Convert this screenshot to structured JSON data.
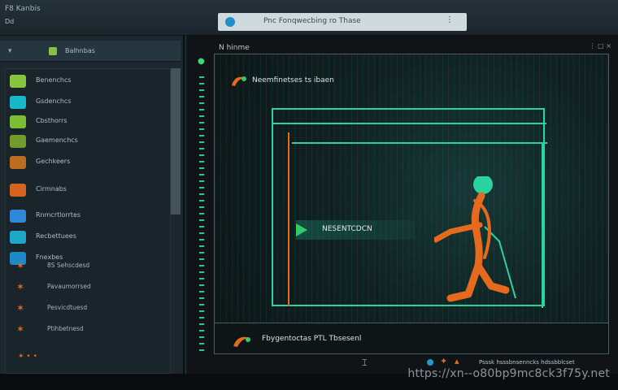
{
  "window": {
    "app_title": "F8 Kanbis",
    "menu_item": "Dd"
  },
  "addressbar": {
    "text": "Pnc  Fonqwecbing ro Thase",
    "close": "⋮"
  },
  "sidebar": {
    "header_label": "Balhnbas",
    "items": [
      {
        "label": "Benenchcs",
        "icon_color": "#86c440",
        "icon": "leaf-icon"
      },
      {
        "label": "Gsdenchcs",
        "icon_color": "#17b6c9",
        "icon": "monitor-icon"
      },
      {
        "label": "Cbsthorrs",
        "icon_color": "#7bbd35",
        "icon": "leaf-icon"
      },
      {
        "label": "Gaemenchcs",
        "icon_color": "#6f9c2c",
        "icon": "leaf-icon"
      },
      {
        "label": "Gechkeers",
        "icon_color": "#b96f1f",
        "icon": "leaf-icon"
      },
      {
        "label": "Cirmnabs",
        "icon_color": "#d4641f",
        "icon": "tag-icon"
      },
      {
        "label": "Rnmcrtlorrtes",
        "icon_color": "#2f87d6",
        "icon": "window-icon"
      },
      {
        "label": "Recbettuees",
        "icon_color": "#1ea7c9",
        "icon": "window-icon"
      },
      {
        "label": "Fnexbes",
        "icon_color": "#1f88c7",
        "icon": "window-icon"
      },
      {
        "label": "Lobrersd",
        "icon_color": "#2893cf",
        "icon": "window-icon"
      }
    ],
    "subitems": [
      {
        "label": "8S Sehscdesd"
      },
      {
        "label": "Pavaumorrsed"
      },
      {
        "label": "Pesvicdtuesd"
      },
      {
        "label": "Ptihbetnesd"
      }
    ],
    "footer_glyph": "✶ • •"
  },
  "main": {
    "title": "N hinme",
    "stage_title": "Neemfinetses ts ibaen",
    "tag_label": "NESENTCDCN",
    "status_label": "Fbygentoctas PTL Tbsesenl",
    "bottom_text": "Psssk hsssbnsenncks hdssbblcset",
    "right_glyph": "⋮ □ ×"
  },
  "watermark": "https://xn--o80bp9mc8ck3f75y.net",
  "colors": {
    "accent_green": "#2bd3a1",
    "accent_orange": "#e66a1e",
    "url_bar": "#cfd9de"
  }
}
